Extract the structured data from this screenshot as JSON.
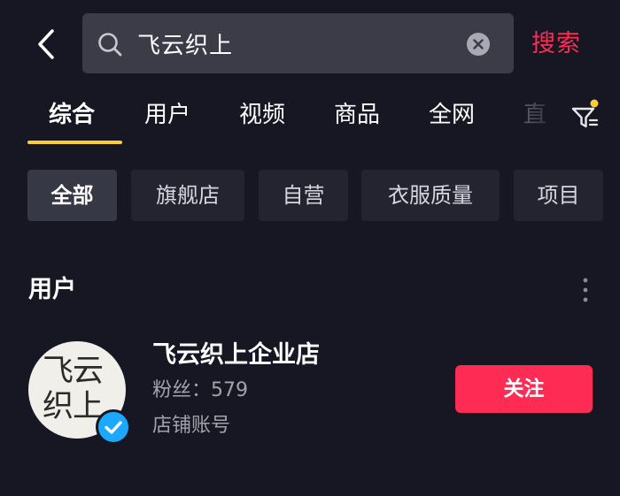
{
  "search": {
    "query": "飞云织上",
    "submit_label": "搜索"
  },
  "tabs": [
    {
      "label": "综合",
      "active": true
    },
    {
      "label": "用户"
    },
    {
      "label": "视频"
    },
    {
      "label": "商品"
    },
    {
      "label": "全网"
    },
    {
      "label": "直"
    }
  ],
  "filters": [
    {
      "label": "全部",
      "active": true
    },
    {
      "label": "旗舰店"
    },
    {
      "label": "自营"
    },
    {
      "label": "衣服质量"
    },
    {
      "label": "项目"
    }
  ],
  "users_section": {
    "title": "用户",
    "result": {
      "avatar_text": "飞云织上",
      "name": "飞云织上企业店",
      "fans": "粉丝：579",
      "account_type": "店铺账号",
      "follow_label": "关注",
      "verified": true
    }
  },
  "colors": {
    "background": "#161723",
    "accent": "#fe2c55",
    "tab_underline": "#facd3c",
    "verified": "#1ca8ff"
  },
  "icons": {
    "back": "chevron-left-icon",
    "search": "search-icon",
    "clear": "clear-icon",
    "filter": "filter-icon",
    "more": "more-vertical-icon",
    "verified": "verified-check-icon"
  }
}
